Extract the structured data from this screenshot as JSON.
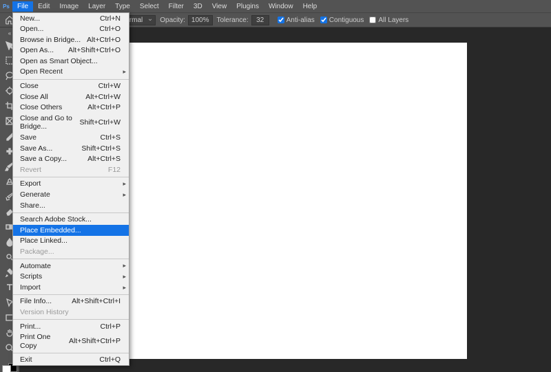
{
  "menubar": {
    "items": [
      "File",
      "Edit",
      "Image",
      "Layer",
      "Type",
      "Select",
      "Filter",
      "3D",
      "View",
      "Plugins",
      "Window",
      "Help"
    ],
    "active_index": 0
  },
  "options": {
    "mode_label": "Normal",
    "opacity_label": "Opacity:",
    "opacity_value": "100%",
    "tolerance_label": "Tolerance:",
    "tolerance_value": "32",
    "checks": [
      {
        "label": "Anti-alias",
        "checked": true
      },
      {
        "label": "Contiguous",
        "checked": true
      },
      {
        "label": "All Layers",
        "checked": false
      }
    ]
  },
  "file_menu": [
    {
      "label": "New...",
      "shortcut": "Ctrl+N"
    },
    {
      "label": "Open...",
      "shortcut": "Ctrl+O"
    },
    {
      "label": "Browse in Bridge...",
      "shortcut": "Alt+Ctrl+O"
    },
    {
      "label": "Open As...",
      "shortcut": "Alt+Shift+Ctrl+O"
    },
    {
      "label": "Open as Smart Object..."
    },
    {
      "label": "Open Recent",
      "submenu": true
    },
    {
      "sep": true
    },
    {
      "label": "Close",
      "shortcut": "Ctrl+W"
    },
    {
      "label": "Close All",
      "shortcut": "Alt+Ctrl+W"
    },
    {
      "label": "Close Others",
      "shortcut": "Alt+Ctrl+P"
    },
    {
      "label": "Close and Go to Bridge...",
      "shortcut": "Shift+Ctrl+W"
    },
    {
      "label": "Save",
      "shortcut": "Ctrl+S"
    },
    {
      "label": "Save As...",
      "shortcut": "Shift+Ctrl+S"
    },
    {
      "label": "Save a Copy...",
      "shortcut": "Alt+Ctrl+S"
    },
    {
      "label": "Revert",
      "shortcut": "F12",
      "disabled": true
    },
    {
      "sep": true
    },
    {
      "label": "Export",
      "submenu": true
    },
    {
      "label": "Generate",
      "submenu": true
    },
    {
      "label": "Share..."
    },
    {
      "sep": true
    },
    {
      "label": "Search Adobe Stock..."
    },
    {
      "label": "Place Embedded...",
      "selected": true
    },
    {
      "label": "Place Linked..."
    },
    {
      "label": "Package...",
      "disabled": true
    },
    {
      "sep": true
    },
    {
      "label": "Automate",
      "submenu": true
    },
    {
      "label": "Scripts",
      "submenu": true
    },
    {
      "label": "Import",
      "submenu": true
    },
    {
      "sep": true
    },
    {
      "label": "File Info...",
      "shortcut": "Alt+Shift+Ctrl+I"
    },
    {
      "label": "Version History",
      "disabled": true
    },
    {
      "sep": true
    },
    {
      "label": "Print...",
      "shortcut": "Ctrl+P"
    },
    {
      "label": "Print One Copy",
      "shortcut": "Alt+Shift+Ctrl+P"
    },
    {
      "sep": true
    },
    {
      "label": "Exit",
      "shortcut": "Ctrl+Q"
    }
  ],
  "tools": [
    "move-tool",
    "marquee-tool",
    "lasso-tool",
    "quick-select-tool",
    "crop-tool",
    "frame-tool",
    "eyedropper-tool",
    "spot-heal-tool",
    "brush-tool",
    "clone-stamp-tool",
    "history-brush-tool",
    "eraser-tool",
    "gradient-tool",
    "blur-tool",
    "dodge-tool",
    "pen-tool",
    "type-tool",
    "path-select-tool",
    "rectangle-tool",
    "hand-tool",
    "zoom-tool"
  ]
}
